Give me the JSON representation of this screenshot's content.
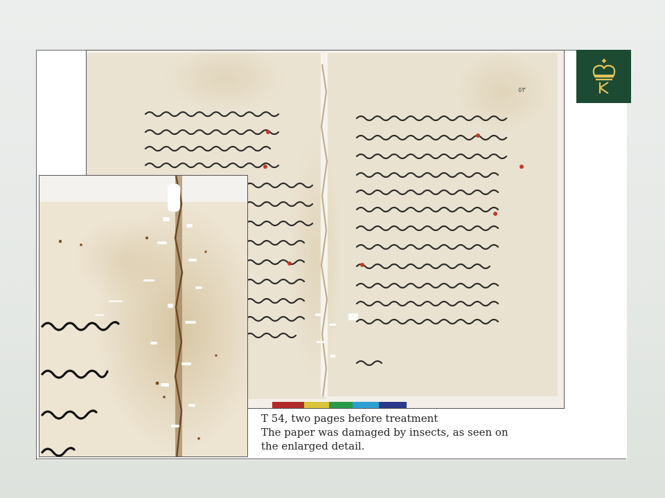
{
  "caption": {
    "title": "T 54, two pages before treatment",
    "line1": "The paper was damaged by insects, as seen on",
    "line2": "the enlarged detail."
  },
  "logo": {
    "icon": "crown-k-logo-icon",
    "color": "#1d4a33"
  },
  "images": {
    "manuscript": "manuscript-two-pages-photo",
    "detail": "enlarged-insect-damage-detail"
  },
  "colors": {
    "paper": "#e8dfcd",
    "ink": "#2a2a2a",
    "logo_bg": "#1d4a33"
  }
}
